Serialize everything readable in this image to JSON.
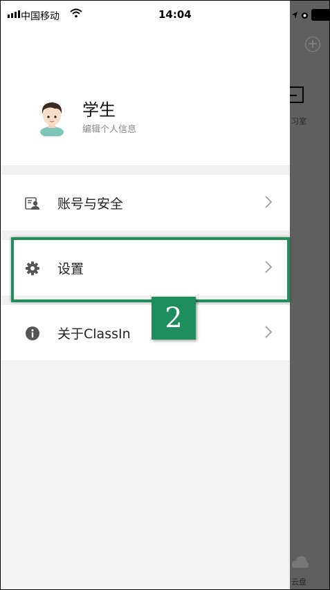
{
  "status_bar": {
    "carrier": "中国移动",
    "time": "14:04"
  },
  "background_app": {
    "label_top": "习室",
    "label_bottom": "云盘"
  },
  "profile": {
    "name": "学生",
    "subtitle": "编辑个人信息"
  },
  "menu": {
    "items": [
      {
        "label": "账号与安全",
        "icon": "id-card-icon"
      },
      {
        "label": "设置",
        "icon": "gear-icon"
      },
      {
        "label": "关于ClassIn",
        "icon": "info-icon"
      }
    ]
  },
  "annotation": {
    "step": "2",
    "color": "#1e8f5c"
  }
}
